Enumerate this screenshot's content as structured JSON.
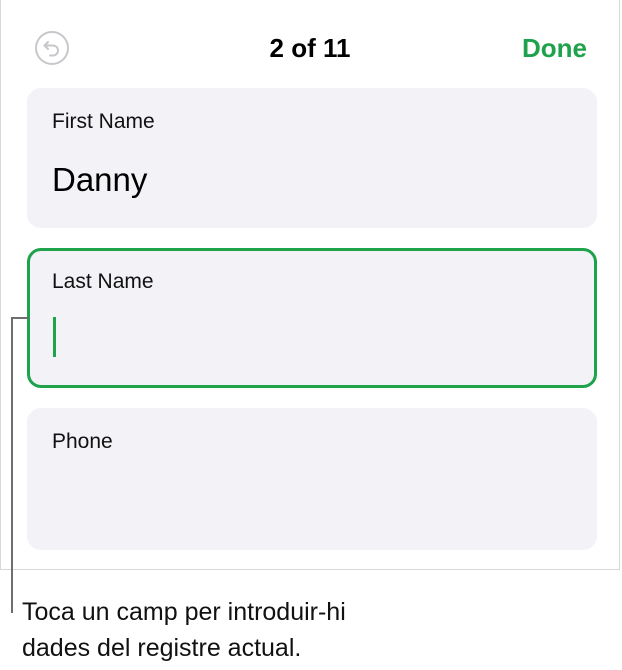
{
  "header": {
    "undo_icon": "undo-arrow-icon",
    "record_counter": "2 of 11",
    "done_label": "Done",
    "accent_color": "#1ea24b"
  },
  "fields": [
    {
      "label": "First Name",
      "value": "Danny"
    },
    {
      "label": "Last Name",
      "value": ""
    },
    {
      "label": "Phone",
      "value": ""
    }
  ],
  "callout": {
    "line1": "Toca un camp per introduir-hi",
    "line2": "dades del registre actual."
  }
}
